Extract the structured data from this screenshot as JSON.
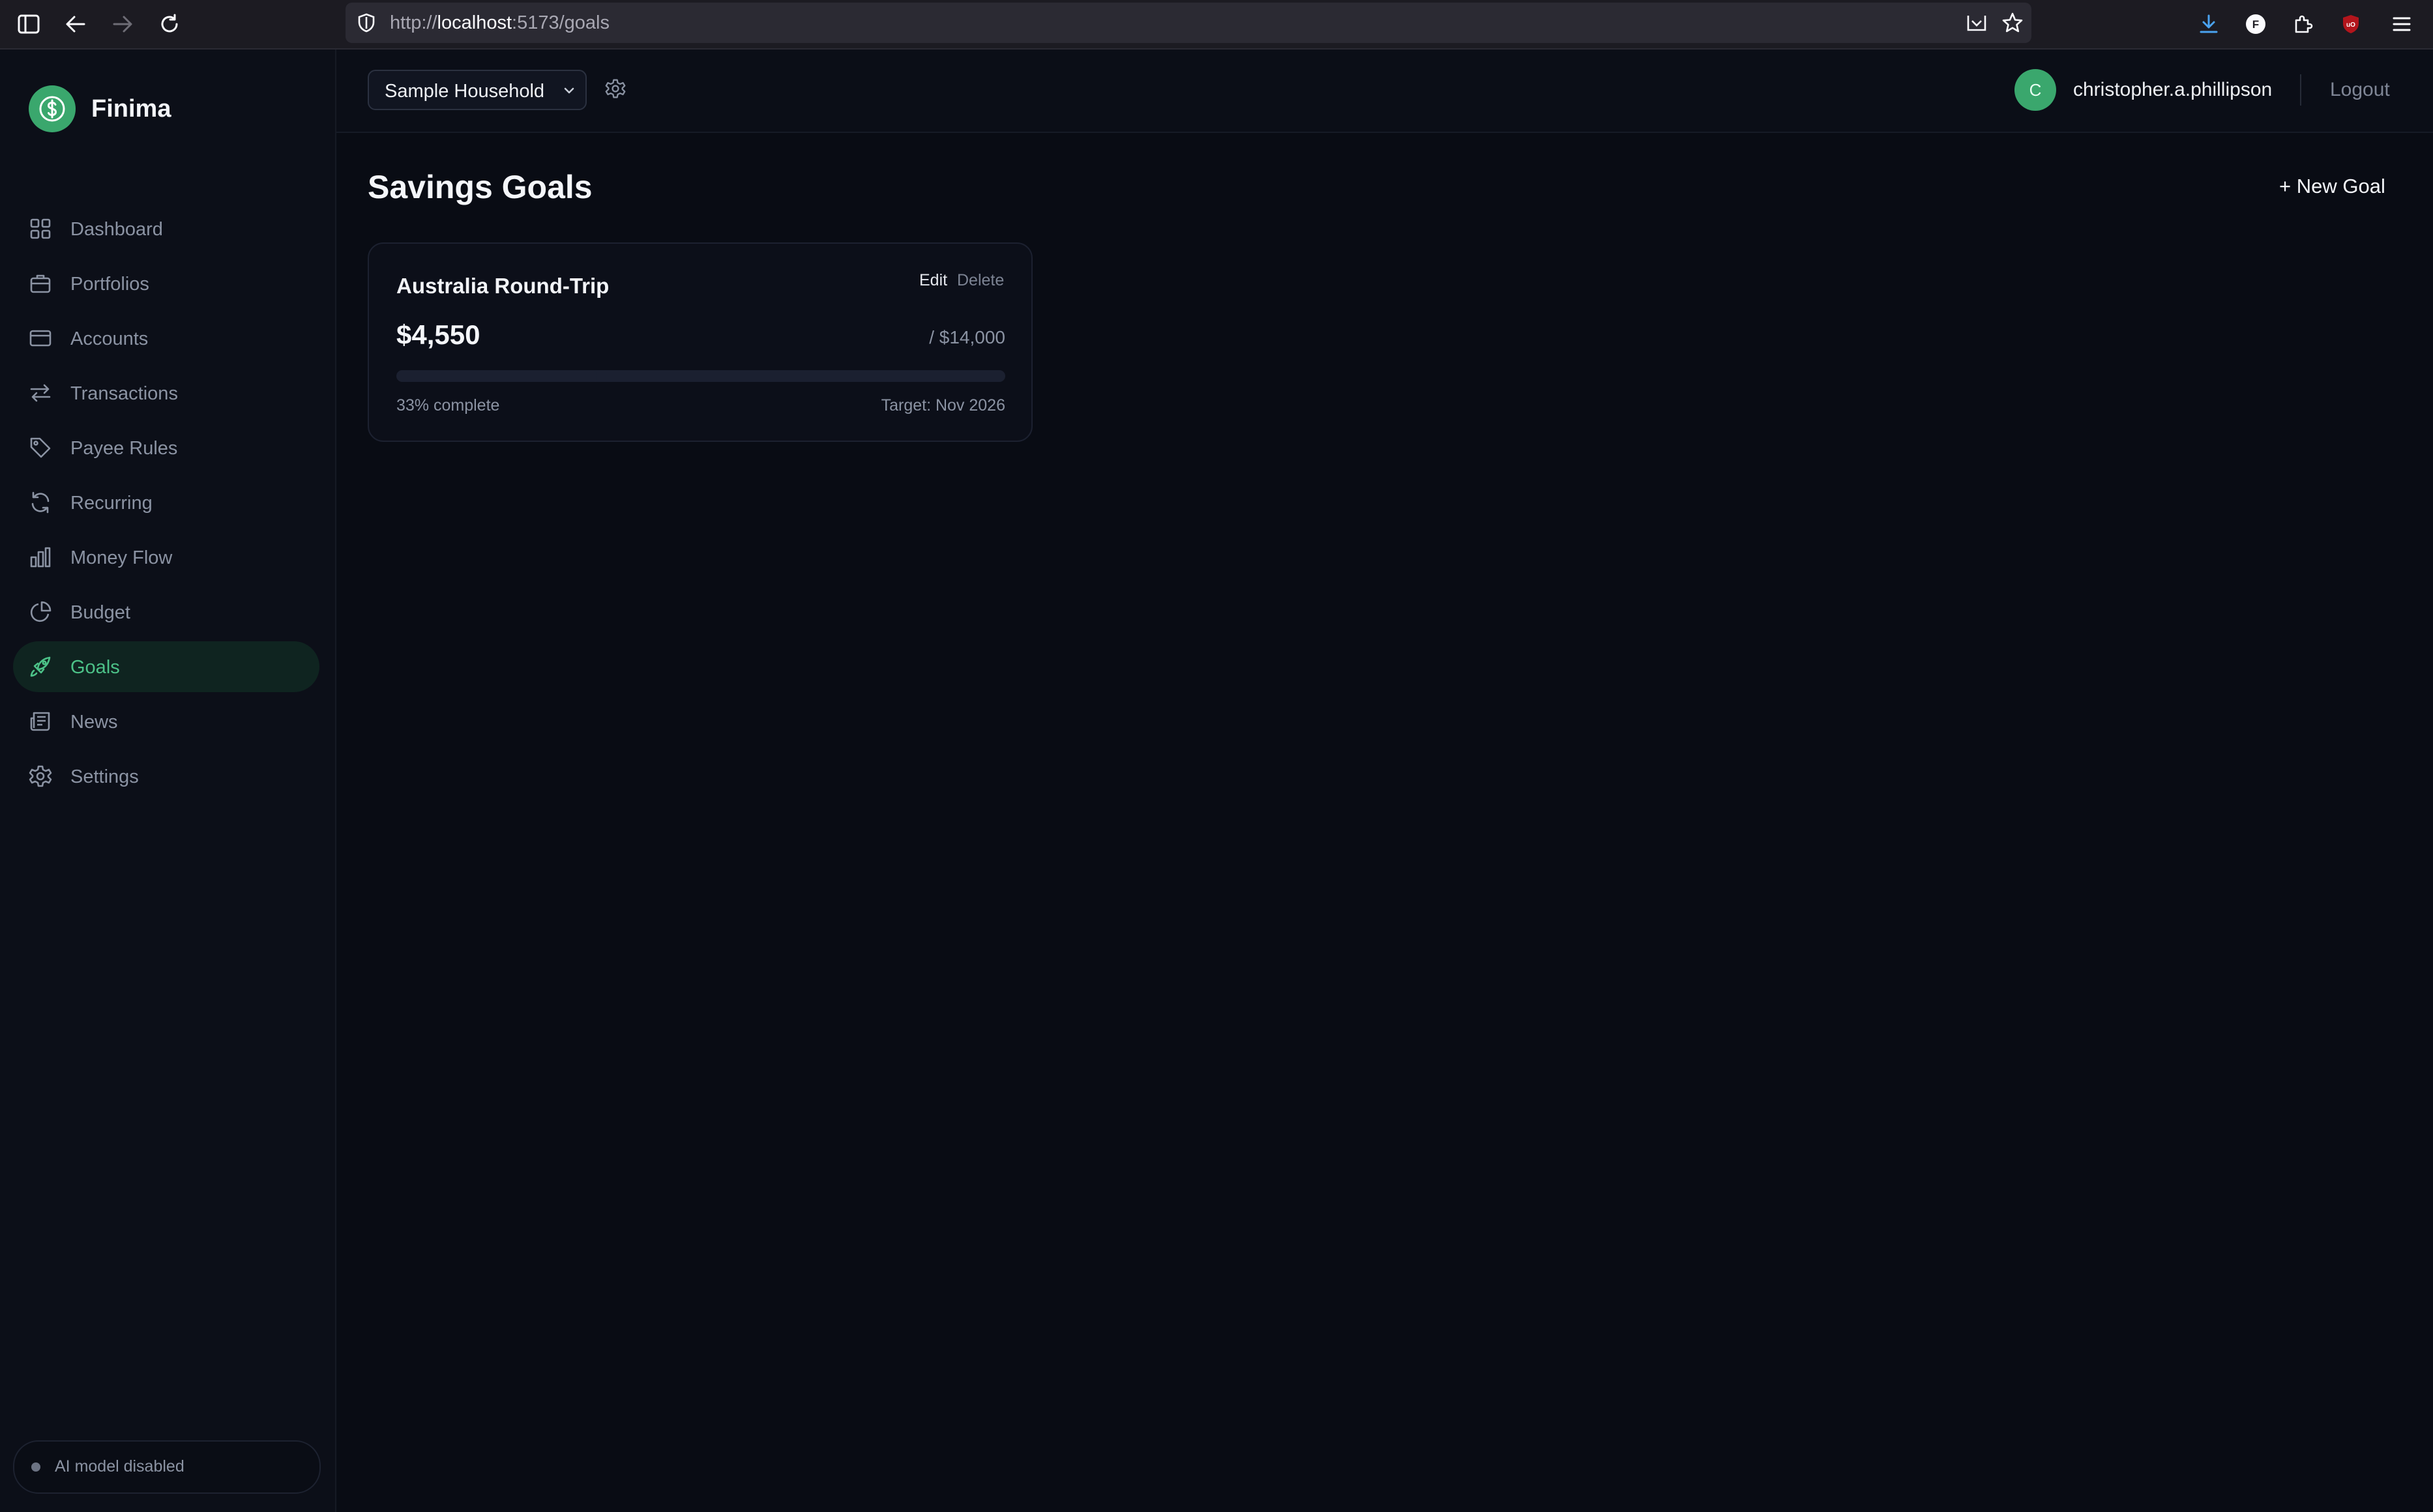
{
  "browser": {
    "url_scheme": "http://",
    "url_host": "localhost",
    "url_path": ":5173/goals"
  },
  "app": {
    "brand": "Finima",
    "accent_color": "#3aa76d"
  },
  "sidebar": {
    "items": [
      {
        "label": "Dashboard",
        "icon": "grid-icon"
      },
      {
        "label": "Portfolios",
        "icon": "briefcase-icon"
      },
      {
        "label": "Accounts",
        "icon": "credit-card-icon"
      },
      {
        "label": "Transactions",
        "icon": "arrows-swap-icon"
      },
      {
        "label": "Payee Rules",
        "icon": "tag-icon"
      },
      {
        "label": "Recurring",
        "icon": "refresh-icon"
      },
      {
        "label": "Money Flow",
        "icon": "bar-chart-icon"
      },
      {
        "label": "Budget",
        "icon": "pie-chart-icon"
      },
      {
        "label": "Goals",
        "icon": "rocket-icon",
        "active": true
      },
      {
        "label": "News",
        "icon": "newspaper-icon"
      },
      {
        "label": "Settings",
        "icon": "gear-icon"
      }
    ],
    "ai_status": "AI model disabled"
  },
  "topbar": {
    "household": "Sample Household",
    "avatar_initial": "C",
    "username": "christopher.a.phillipson",
    "logout": "Logout"
  },
  "main": {
    "title": "Savings Goals",
    "new_goal": "+ New Goal",
    "goals": [
      {
        "name": "Australia Round-Trip",
        "edit": "Edit",
        "delete": "Delete",
        "current": "$4,550",
        "target": "/ $14,000",
        "percent_label": "33% complete",
        "progress": 0.33,
        "target_date": "Target: Nov 2026"
      }
    ]
  }
}
